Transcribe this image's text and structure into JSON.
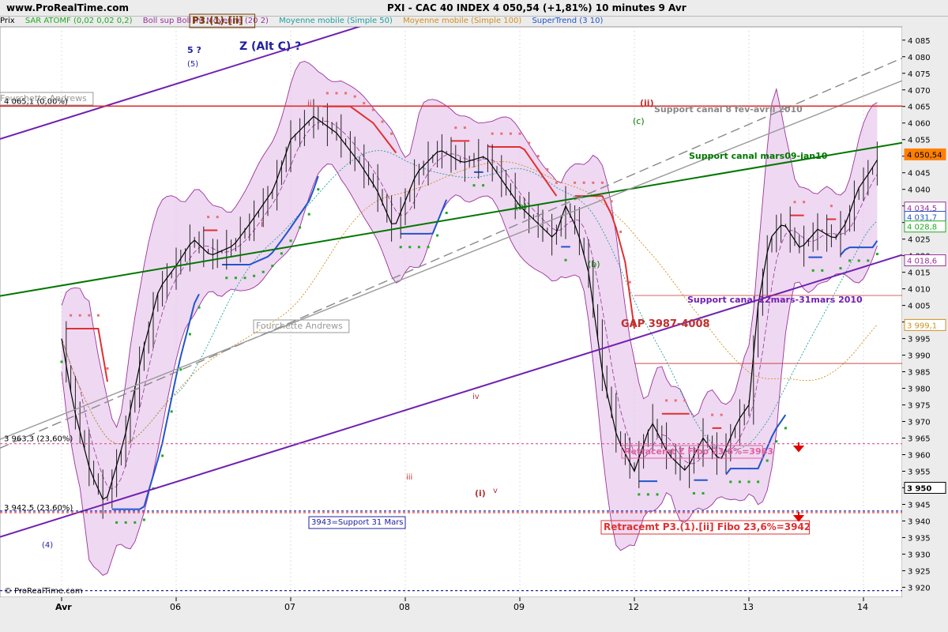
{
  "header": {
    "site": "www.ProRealTime.com",
    "title": "PXI - CAC 40 INDEX    4 050,54 (+1,81%)    10 minutes  9 Avr"
  },
  "legend": [
    {
      "label": "Prix",
      "color": "#000000"
    },
    {
      "label": "SAR ATOMF (0,02 0,02 0,2)",
      "color": "#22aa22"
    },
    {
      "label": "Boll sup Boll inf Moyenne (20 2)",
      "color": "#993399"
    },
    {
      "label": "Moyenne mobile (Simple 50)",
      "color": "#20a0a0"
    },
    {
      "label": "Moyenne mobile (Simple 100)",
      "color": "#d09020"
    },
    {
      "label": "SuperTrend (3 10)",
      "color": "#2255cc"
    }
  ],
  "chart_data": {
    "type": "line",
    "subtype": "candlestick-intraday",
    "instrument": "PXI - CAC 40 INDEX",
    "timeframe": "10 minutes",
    "ylim": [
      3917,
      4089
    ],
    "y_ticks": [
      3920,
      3925,
      3930,
      3935,
      3940,
      3945,
      3950,
      3955,
      3960,
      3965,
      3970,
      3975,
      3980,
      3985,
      3990,
      3995,
      4000,
      4005,
      4010,
      4015,
      4020,
      4025,
      4030,
      4035,
      4040,
      4045,
      4050,
      4055,
      4060,
      4065,
      4070,
      4075,
      4080,
      4085
    ],
    "x_ticks": [
      "Avr",
      "06",
      "07",
      "08",
      "09",
      "12",
      "13",
      "14"
    ],
    "x_tick_days": [
      1,
      2,
      3,
      4,
      5,
      6,
      7,
      8
    ],
    "sessions": [
      1,
      2,
      3,
      4,
      5,
      6
    ],
    "price_path": [
      [
        1.0,
        3995
      ],
      [
        1.1,
        3975
      ],
      [
        1.25,
        3955
      ],
      [
        1.38,
        3945
      ],
      [
        1.55,
        3965
      ],
      [
        1.7,
        3990
      ],
      [
        1.85,
        4010
      ],
      [
        2.0,
        4017
      ],
      [
        2.15,
        4025
      ],
      [
        2.3,
        4020
      ],
      [
        2.5,
        4023
      ],
      [
        2.65,
        4030
      ],
      [
        2.85,
        4040
      ],
      [
        3.0,
        4055
      ],
      [
        3.2,
        4062
      ],
      [
        3.4,
        4057
      ],
      [
        3.6,
        4048
      ],
      [
        3.75,
        4040
      ],
      [
        3.9,
        4028
      ],
      [
        4.1,
        4045
      ],
      [
        4.3,
        4052
      ],
      [
        4.5,
        4048
      ],
      [
        4.7,
        4050
      ],
      [
        4.9,
        4040
      ],
      [
        5.0,
        4035
      ],
      [
        5.15,
        4030
      ],
      [
        5.3,
        4025
      ],
      [
        5.4,
        4035
      ],
      [
        5.5,
        4028
      ],
      [
        5.6,
        4015
      ],
      [
        5.72,
        3985
      ],
      [
        5.85,
        3965
      ],
      [
        6.0,
        3955
      ],
      [
        6.15,
        3970
      ],
      [
        6.3,
        3960
      ],
      [
        6.45,
        3955
      ],
      [
        6.6,
        3965
      ],
      [
        6.75,
        3958
      ],
      [
        6.9,
        3970
      ],
      [
        7.0,
        3975
      ],
      [
        7.08,
        4005
      ],
      [
        7.18,
        4025
      ],
      [
        7.3,
        4030
      ],
      [
        7.45,
        4022
      ],
      [
        7.6,
        4028
      ],
      [
        7.75,
        4025
      ],
      [
        7.85,
        4030
      ],
      [
        7.95,
        4040
      ],
      [
        8.05,
        4045
      ],
      [
        8.15,
        4050.54
      ]
    ],
    "last_price": 4050.54,
    "price_labels": [
      {
        "value": 4050.54,
        "text": "4 050,54",
        "color": "#ff8000"
      },
      {
        "value": 4034.5,
        "text": "4 034,5",
        "color": "#993399"
      },
      {
        "value": 4031.7,
        "text": "4 031,7",
        "color": "#2255cc"
      },
      {
        "value": 4028.8,
        "text": "4 028,8",
        "color": "#22aa22"
      },
      {
        "value": 4018.6,
        "text": "4 018,6",
        "color": "#993399"
      },
      {
        "value": 3999.1,
        "text": "3 999,1",
        "color": "#d09020"
      },
      {
        "value": 3950,
        "text": "3 950",
        "color": "#000000"
      }
    ],
    "levels": [
      {
        "value": 4065.1,
        "text": "4 065,1 (0,00%)",
        "color": "#e03030"
      },
      {
        "value": 3963.3,
        "text": "3 963,3 (23,60%)",
        "color": "#e060a0"
      },
      {
        "value": 3942.5,
        "text": "3 942,5 (23,60%)",
        "color": "#e03030"
      },
      {
        "value": 3943,
        "text": "",
        "color": "#2020a0"
      },
      {
        "value": 3919,
        "text": "",
        "color": "#2020a0"
      },
      {
        "value": 4008,
        "text": "",
        "color": "#c03030"
      },
      {
        "value": 3987.5,
        "text": "",
        "color": "#c03030"
      }
    ],
    "trendlines": [
      {
        "name": "Support canal mars09-jan10",
        "color": "#007700",
        "points": [
          [
            1.0,
            4011
          ],
          [
            8.5,
            4055
          ]
        ]
      },
      {
        "name": "Support canal 22mars-31mars 2010",
        "color": "#7020b0",
        "points": [
          [
            1.0,
            3941
          ],
          [
            8.5,
            4022
          ]
        ]
      },
      {
        "name": "Support canal 8 fév-avril 2010",
        "color": "#888888",
        "points": [
          [
            1.0,
            3970
          ],
          [
            8.5,
            4082
          ]
        ]
      },
      {
        "name": "Fourchette Andrews",
        "color": "#999999",
        "points": [
          [
            1.0,
            3972
          ],
          [
            8.5,
            4075
          ]
        ]
      }
    ],
    "annotations": [
      {
        "text": "P3.(1).[ii]",
        "color": "#7a3a00"
      },
      {
        "text": "5 ?",
        "color": "#2020a0"
      },
      {
        "text": "(5)",
        "color": "#2020a0"
      },
      {
        "text": "Z (Alt C) ?",
        "color": "#2020a0"
      },
      {
        "text": "Fourchette Andrews",
        "color": "#999999"
      },
      {
        "text": "Fourchette Andrews",
        "color": "#999999"
      },
      {
        "text": "ii",
        "color": "#c03030"
      },
      {
        "text": "i",
        "color": "#c03030"
      },
      {
        "text": "iii",
        "color": "#c03030"
      },
      {
        "text": "iv",
        "color": "#c03030"
      },
      {
        "text": "v",
        "color": "#c03030"
      },
      {
        "text": "(i)",
        "color": "#c03030"
      },
      {
        "text": "(ii)",
        "color": "#c03030"
      },
      {
        "text": "(a)",
        "color": "#007700"
      },
      {
        "text": "(b)",
        "color": "#007700"
      },
      {
        "text": "(c)",
        "color": "#007700"
      },
      {
        "text": "(4)",
        "color": "#2020a0"
      },
      {
        "text": "Support canal 8 fév-avril 2010",
        "color": "#888888"
      },
      {
        "text": "Support canal mars09-jan10",
        "color": "#007700"
      },
      {
        "text": "Support canal 22mars-31mars 2010",
        "color": "#7020b0"
      },
      {
        "text": "GAP 3987-4008",
        "color": "#c03030"
      },
      {
        "text": "Retracemt Z Fibo 23,6%=3963",
        "color": "#e060a0"
      },
      {
        "text": "Retracemt P3.(1).[ii] Fibo 23,6%=3942",
        "color": "#e03030"
      },
      {
        "text": "3943=Support 31 Mars",
        "color": "#2020a0"
      },
      {
        "text": "© ProRealTime.com",
        "color": "#000000"
      }
    ]
  }
}
